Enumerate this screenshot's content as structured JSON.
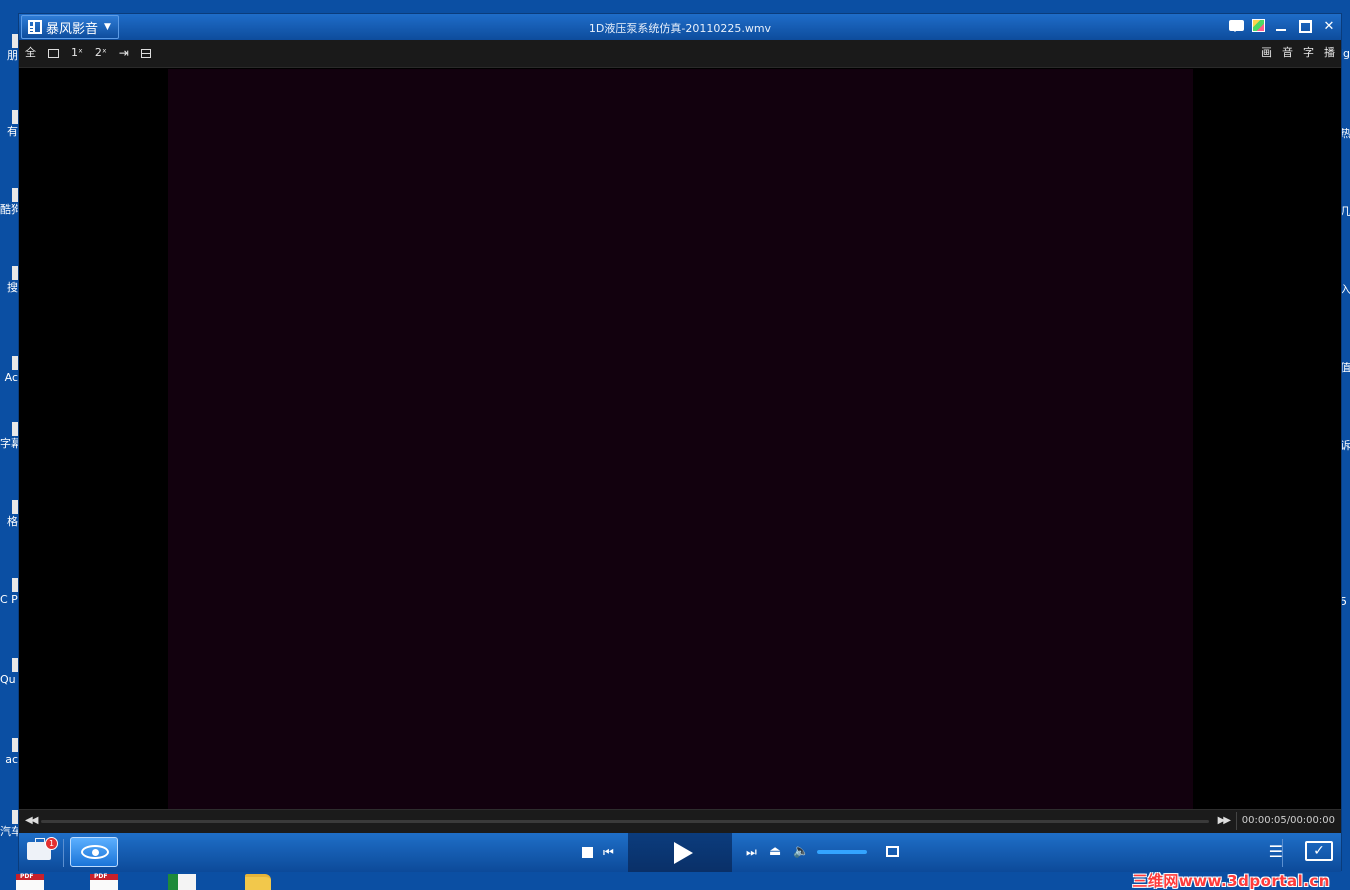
{
  "desktop": {
    "left_icons": [
      "朋",
      "有",
      "酷狗",
      "搜",
      "Ac",
      "字幕",
      "格",
      "C Pro",
      "Qu F",
      "ac",
      "汽车 主动"
    ],
    "right_icons": [
      "ig",
      "热",
      "几",
      "入",
      "值",
      "诉",
      "5"
    ],
    "watermark": "三维网www.3dportal.cn"
  },
  "player": {
    "app_name": "暴风影音",
    "window_title": "1D液压泵系统仿真-20110225.wmv",
    "toolbar_left": {
      "full": "全",
      "scale_1x": "1ˣ",
      "scale_2x": "2ˣ"
    },
    "toolbar_right": {
      "picture": "画",
      "audio": "音",
      "subtitle": "字",
      "playback": "播"
    },
    "time": "00:00:05/00:00:00",
    "notification_count": "1",
    "volume_level": 1.0,
    "colors": {
      "accent": "#1f6fc8",
      "video_frame": "#12010e",
      "volume_fill": "#33a4ff"
    }
  }
}
